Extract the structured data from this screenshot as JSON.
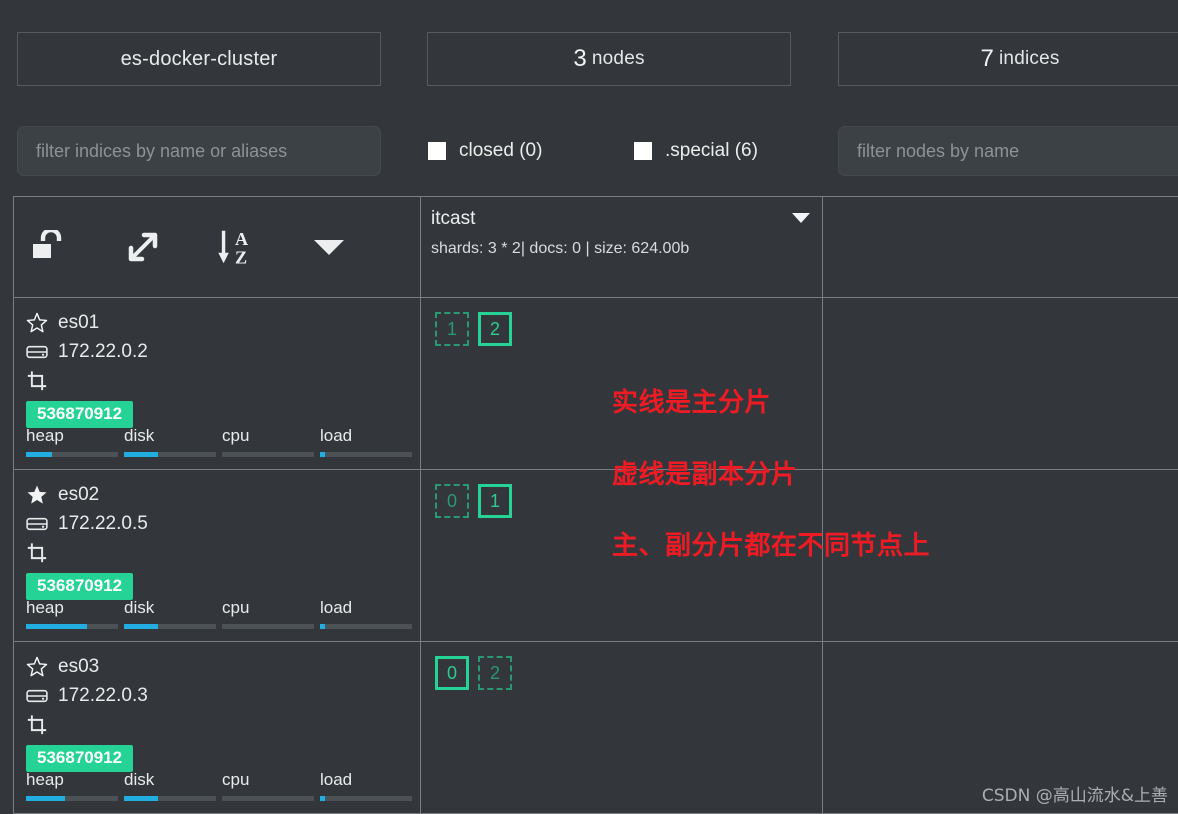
{
  "summary": {
    "cluster_name": "es-docker-cluster",
    "nodes_count": "3",
    "nodes_label": "nodes",
    "indices_count": "7",
    "indices_label": "indices"
  },
  "filters": {
    "indices_placeholder": "filter indices by name or aliases",
    "nodes_placeholder": "filter nodes by name",
    "indices_value": "",
    "nodes_value": "",
    "closed_label": "closed (0)",
    "special_label": ".special (6)",
    "closed_checked": false,
    "special_checked": false
  },
  "toolbar": {
    "icons": [
      {
        "name": "unlock-icon",
        "title": "unlock"
      },
      {
        "name": "expand-icon",
        "title": "expand"
      },
      {
        "name": "sort-az-icon",
        "title": "sort A-Z"
      },
      {
        "name": "chevron-down-icon",
        "title": "more"
      }
    ]
  },
  "index": {
    "name": "itcast",
    "meta": "shards: 3 * 2| docs: 0 | size: 624.00b"
  },
  "nodes": [
    {
      "name": "es01",
      "master": false,
      "ip": "172.22.0.2",
      "memory": "536870912",
      "metrics": [
        {
          "label": "heap",
          "pct": 28
        },
        {
          "label": "disk",
          "pct": 37
        },
        {
          "label": "cpu",
          "pct": 0
        },
        {
          "label": "load",
          "pct": 5
        }
      ],
      "shards": [
        {
          "id": "1",
          "type": "replica"
        },
        {
          "id": "2",
          "type": "primary"
        }
      ]
    },
    {
      "name": "es02",
      "master": true,
      "ip": "172.22.0.5",
      "memory": "536870912",
      "metrics": [
        {
          "label": "heap",
          "pct": 66
        },
        {
          "label": "disk",
          "pct": 37
        },
        {
          "label": "cpu",
          "pct": 0
        },
        {
          "label": "load",
          "pct": 5
        }
      ],
      "shards": [
        {
          "id": "0",
          "type": "replica"
        },
        {
          "id": "1",
          "type": "primary"
        }
      ]
    },
    {
      "name": "es03",
      "master": false,
      "ip": "172.22.0.3",
      "memory": "536870912",
      "metrics": [
        {
          "label": "heap",
          "pct": 42
        },
        {
          "label": "disk",
          "pct": 37
        },
        {
          "label": "cpu",
          "pct": 0
        },
        {
          "label": "load",
          "pct": 5
        }
      ],
      "shards": [
        {
          "id": "0",
          "type": "primary"
        },
        {
          "id": "2",
          "type": "replica"
        }
      ]
    }
  ],
  "annotation": {
    "line1": "实线是主分片",
    "line2": "虚线是副本分片",
    "line3": "主、副分片都在不同节点上",
    "color": "#ef1b24"
  },
  "watermark": "CSDN @高山流水&上善",
  "colors": {
    "background": "#33373b",
    "border": "#787e84",
    "accent_green": "#24d395",
    "accent_blue": "#22aee0",
    "annotation_red": "#ef1b24"
  }
}
